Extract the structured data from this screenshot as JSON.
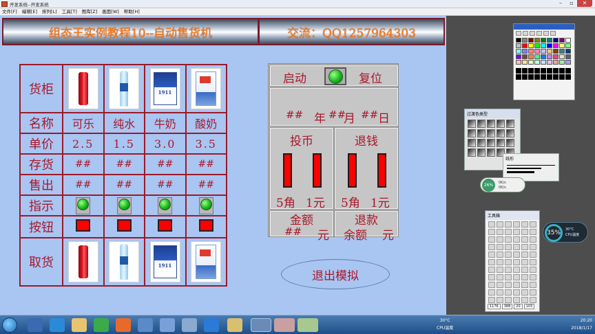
{
  "window": {
    "title": "开发系统--开发系统"
  },
  "menu": [
    "文件[F]",
    "编辑[E]",
    "排列[L]",
    "工具[T]",
    "图库[Z]",
    "画面[W]",
    "帮助[H]"
  ],
  "header": {
    "title": "组态王实例教程10--自动售货机",
    "contact": "交流：QQ1257964303"
  },
  "grid": {
    "row_labels": {
      "cabinet": "货柜",
      "name": "名称",
      "price": "单价",
      "stock": "存货",
      "sold": "售出",
      "indicator": "指示",
      "button": "按钮",
      "pickup": "取货"
    },
    "products": [
      {
        "name": "可乐",
        "price": "2.5",
        "stock": "##",
        "sold": "##",
        "image": "cola-can-image"
      },
      {
        "name": "纯水",
        "price": "1.5",
        "stock": "##",
        "sold": "##",
        "image": "water-bottle-image"
      },
      {
        "name": "牛奶",
        "price": "3.0",
        "stock": "##",
        "sold": "##",
        "image": "milk-carton-image"
      },
      {
        "name": "酸奶",
        "price": "3.5",
        "stock": "##",
        "sold": "##",
        "image": "yogurt-carton-image"
      }
    ]
  },
  "panel": {
    "start": "启动",
    "reset": "复位",
    "date": {
      "year": "##",
      "year_unit": "年",
      "month": "##",
      "month_unit": "月",
      "day": "##",
      "day_unit": "日"
    },
    "coin": "投币",
    "refund": "退钱",
    "jiao5": "5角",
    "yuan1": "1元",
    "amount": "金额",
    "return": "退款",
    "amount_value": "##",
    "amount_unit": "元",
    "balance_label": "余额",
    "balance_unit": "元"
  },
  "exit_button": "退出模拟",
  "side": {
    "fill_palette_title": "过渡色类型",
    "line_palette_title": "线形",
    "net_pct": "26%",
    "net_up": "0K/s",
    "net_down": "0K/s",
    "toolbox_title": "工具箱",
    "coords": [
      "1176",
      "388",
      "20",
      "103"
    ],
    "cpu_pct": "35%",
    "cpu_temp": "30°C",
    "cpu_label": "CPU温度"
  },
  "taskbar": {
    "temp": "30°C",
    "temp_label": "CPU温度",
    "time": "20:20",
    "date": "2018/1/17"
  },
  "colors": {
    "canvas": "#a9c5f1",
    "grid_line": "#9c1a28",
    "text_red": "#a8182b",
    "header_text": "#ff7a12",
    "led_green": "#17b81a",
    "button_red": "#ff0000"
  }
}
